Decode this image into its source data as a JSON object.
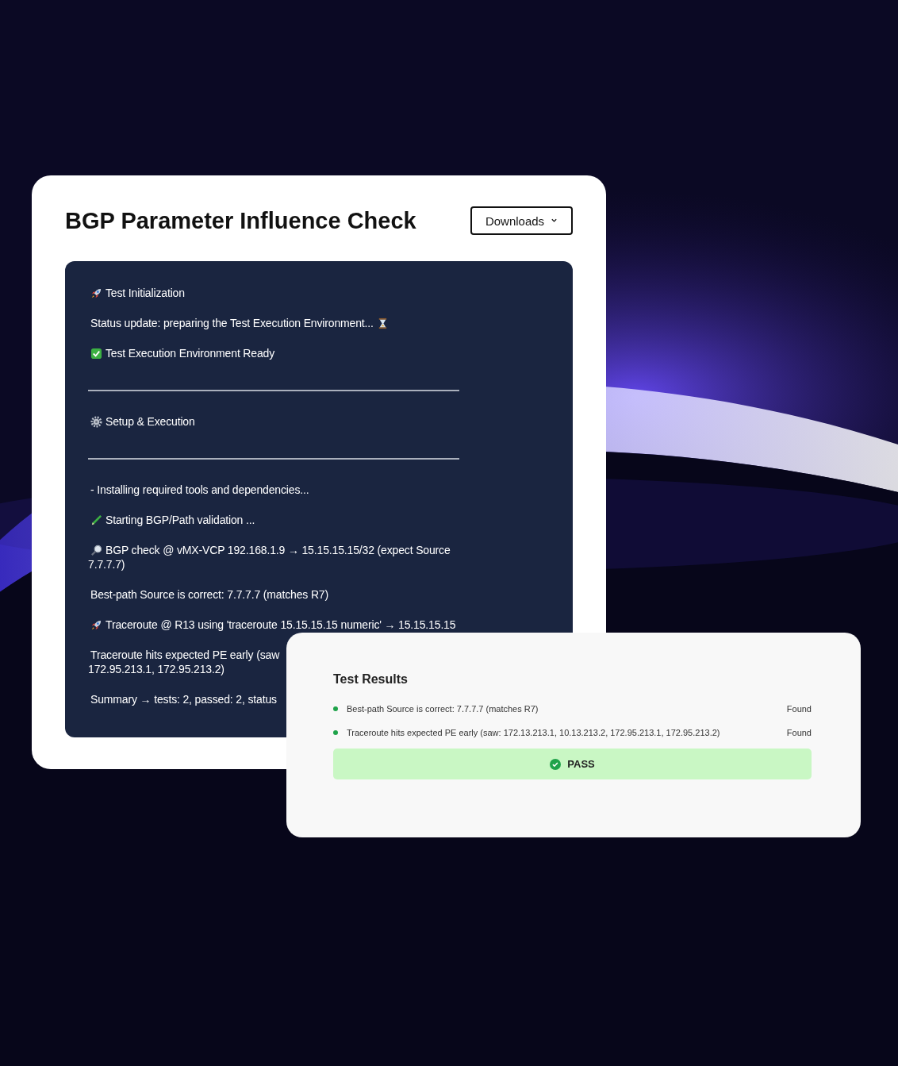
{
  "card": {
    "title": "BGP Parameter Influence Check",
    "downloads_button": "Downloads"
  },
  "log": {
    "sections": [
      {
        "lines": [
          {
            "text": "Test Initialization"
          },
          {
            "text": "Status update: preparing the Test Execution Environment..."
          },
          {
            "text": "Test Execution Environment Ready"
          }
        ]
      },
      {
        "lines": [
          {
            "text": "Setup & Execution"
          }
        ]
      },
      {
        "lines": [
          {
            "text": "- Installing required tools and dependencies..."
          },
          {
            "text": "Starting BGP/Path validation ..."
          },
          {
            "text": "BGP check @ vMX-VCP 192.168.1.9 → 15.15.15.15/32 (expect Source",
            "wrap": "7.7.7.7)"
          },
          {
            "text": "Best-path Source is correct: 7.7.7.7 (matches R7)"
          },
          {
            "text": "Traceroute @ R13 using 'traceroute 15.15.15.15 numeric' → 15.15.15.15"
          },
          {
            "text": "Traceroute hits expected PE early (saw",
            "wrap": "172.95.213.1, 172.95.213.2)"
          },
          {
            "text": "Summary → tests: 2, passed: 2, status"
          }
        ]
      }
    ]
  },
  "results": {
    "title": "Test Results",
    "items": [
      {
        "text": "Best-path Source is correct: 7.7.7.7 (matches R7)",
        "status": "Found",
        "color": "#1fa34a"
      },
      {
        "text": "Traceroute hits expected PE early (saw: 172.13.213.1, 10.13.213.2, 172.95.213.1, 172.95.213.2)",
        "status": "Found",
        "color": "#1fa34a"
      }
    ],
    "verdict": {
      "label": "PASS",
      "passed": true
    }
  }
}
